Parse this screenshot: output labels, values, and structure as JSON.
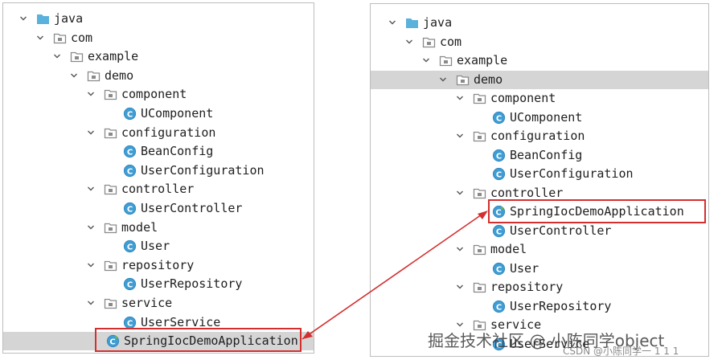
{
  "left_tree": [
    {
      "label": "java",
      "icon": "source-folder-icon",
      "level": 0,
      "expandable": true,
      "highlighted": false
    },
    {
      "label": "com",
      "icon": "package-icon",
      "level": 1,
      "expandable": true,
      "highlighted": false
    },
    {
      "label": "example",
      "icon": "package-icon",
      "level": 2,
      "expandable": true,
      "highlighted": false
    },
    {
      "label": "demo",
      "icon": "package-icon",
      "level": 3,
      "expandable": true,
      "highlighted": false
    },
    {
      "label": "component",
      "icon": "package-icon",
      "level": 4,
      "expandable": true,
      "highlighted": false
    },
    {
      "label": "UComponent",
      "icon": "class-icon",
      "level": 5,
      "expandable": false,
      "highlighted": false
    },
    {
      "label": "configuration",
      "icon": "package-icon",
      "level": 4,
      "expandable": true,
      "highlighted": false
    },
    {
      "label": "BeanConfig",
      "icon": "class-icon",
      "level": 5,
      "expandable": false,
      "highlighted": false
    },
    {
      "label": "UserConfiguration",
      "icon": "class-icon",
      "level": 5,
      "expandable": false,
      "highlighted": false
    },
    {
      "label": "controller",
      "icon": "package-icon",
      "level": 4,
      "expandable": true,
      "highlighted": false
    },
    {
      "label": "UserController",
      "icon": "class-icon",
      "level": 5,
      "expandable": false,
      "highlighted": false
    },
    {
      "label": "model",
      "icon": "package-icon",
      "level": 4,
      "expandable": true,
      "highlighted": false
    },
    {
      "label": "User",
      "icon": "class-icon",
      "level": 5,
      "expandable": false,
      "highlighted": false
    },
    {
      "label": "repository",
      "icon": "package-icon",
      "level": 4,
      "expandable": true,
      "highlighted": false
    },
    {
      "label": "UserRepository",
      "icon": "class-icon",
      "level": 5,
      "expandable": false,
      "highlighted": false
    },
    {
      "label": "service",
      "icon": "package-icon",
      "level": 4,
      "expandable": true,
      "highlighted": false
    },
    {
      "label": "UserService",
      "icon": "class-icon",
      "level": 5,
      "expandable": false,
      "highlighted": false
    },
    {
      "label": "SpringIocDemoApplication",
      "icon": "spring-boot-class-icon",
      "level": 4,
      "expandable": false,
      "highlighted": true,
      "boxed": true
    }
  ],
  "right_tree": [
    {
      "label": "java",
      "icon": "source-folder-icon",
      "level": 0,
      "expandable": true,
      "highlighted": false
    },
    {
      "label": "com",
      "icon": "package-icon",
      "level": 1,
      "expandable": true,
      "highlighted": false
    },
    {
      "label": "example",
      "icon": "package-icon",
      "level": 2,
      "expandable": true,
      "highlighted": false
    },
    {
      "label": "demo",
      "icon": "package-icon",
      "level": 3,
      "expandable": true,
      "highlighted": true
    },
    {
      "label": "component",
      "icon": "package-icon",
      "level": 4,
      "expandable": true,
      "highlighted": false
    },
    {
      "label": "UComponent",
      "icon": "class-icon",
      "level": 5,
      "expandable": false,
      "highlighted": false
    },
    {
      "label": "configuration",
      "icon": "package-icon",
      "level": 4,
      "expandable": true,
      "highlighted": false
    },
    {
      "label": "BeanConfig",
      "icon": "class-icon",
      "level": 5,
      "expandable": false,
      "highlighted": false
    },
    {
      "label": "UserConfiguration",
      "icon": "class-icon",
      "level": 5,
      "expandable": false,
      "highlighted": false
    },
    {
      "label": "controller",
      "icon": "package-icon",
      "level": 4,
      "expandable": true,
      "highlighted": false
    },
    {
      "label": "SpringIocDemoApplication",
      "icon": "spring-boot-class-icon",
      "level": 5,
      "expandable": false,
      "highlighted": false,
      "boxed": true
    },
    {
      "label": "UserController",
      "icon": "class-icon",
      "level": 5,
      "expandable": false,
      "highlighted": false
    },
    {
      "label": "model",
      "icon": "package-icon",
      "level": 4,
      "expandable": true,
      "highlighted": false
    },
    {
      "label": "User",
      "icon": "class-icon",
      "level": 5,
      "expandable": false,
      "highlighted": false
    },
    {
      "label": "repository",
      "icon": "package-icon",
      "level": 4,
      "expandable": true,
      "highlighted": false
    },
    {
      "label": "UserRepository",
      "icon": "class-icon",
      "level": 5,
      "expandable": false,
      "highlighted": false
    },
    {
      "label": "service",
      "icon": "package-icon",
      "level": 4,
      "expandable": true,
      "highlighted": false
    },
    {
      "label": "UserService",
      "icon": "class-icon",
      "level": 5,
      "expandable": false,
      "highlighted": false
    }
  ],
  "watermark": {
    "main": "掘金技术社区 @ 小陈同学object",
    "sub": "CSDN @小陈同学一 1 1 1"
  },
  "colors": {
    "selection": "#d5d5d5",
    "annotation_red": "#d32f2f",
    "class_icon": "#3f9dd4",
    "folder_icon": "#8a8a8a",
    "source_folder_icon": "#5ab1dc",
    "spring_green": "#6db33f"
  }
}
